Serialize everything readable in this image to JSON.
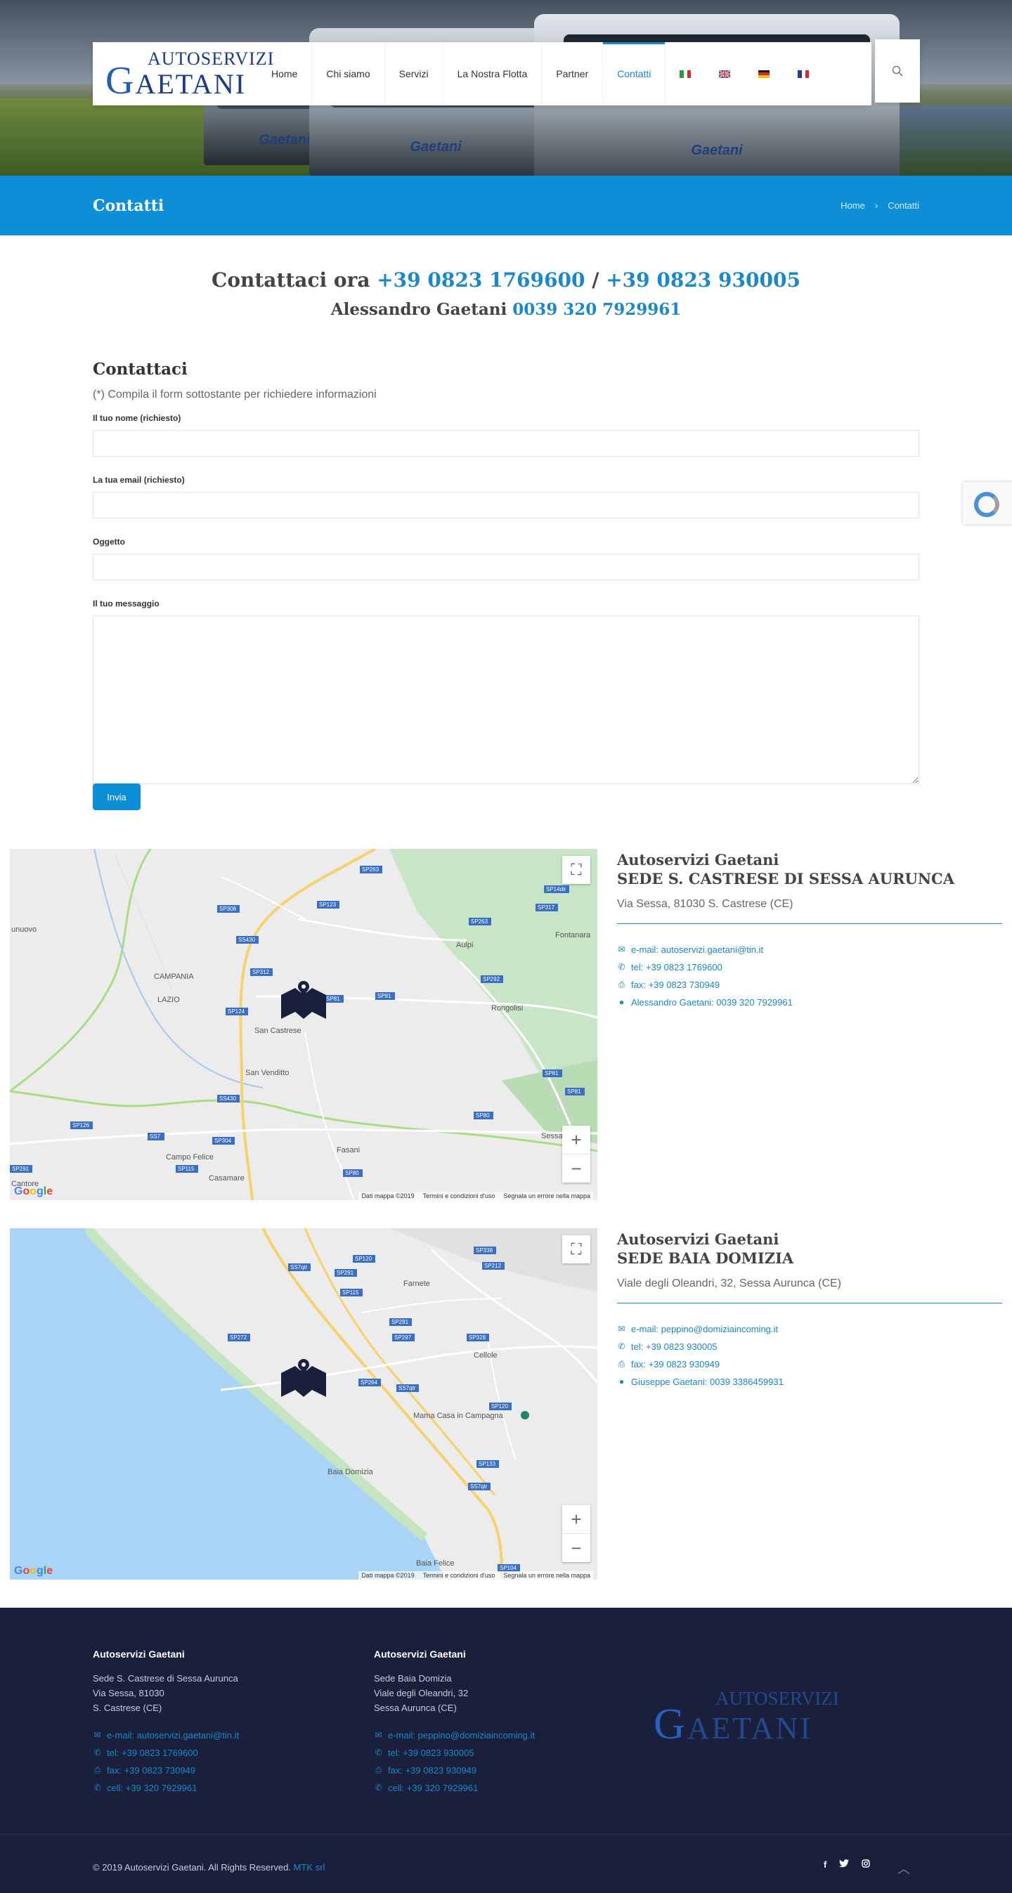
{
  "header": {
    "brand_top": "AUTOSERVIZI",
    "brand_initial": "G",
    "brand_rest": "AETANI",
    "nav": [
      {
        "label": "Home"
      },
      {
        "label": "Chi siamo"
      },
      {
        "label": "Servizi"
      },
      {
        "label": "La Nostra Flotta"
      },
      {
        "label": "Partner"
      },
      {
        "label": "Contatti",
        "active": true
      }
    ],
    "flags": [
      "flag-it-icon",
      "flag-gb-icon",
      "flag-de-icon",
      "flag-fr-icon"
    ],
    "hero_bus_logo": "Gaetani"
  },
  "titlebar": {
    "title": "Contatti",
    "breadcrumb": [
      "Home",
      "Contatti"
    ]
  },
  "cta": {
    "prefix": "Contattaci ora",
    "phone1": "+39 0823 1769600",
    "slash": "/",
    "phone2": "+39 0823 930005",
    "person": "Alessandro Gaetani",
    "person_phone": "0039 320 7929961"
  },
  "form": {
    "title": "Contattaci",
    "hint": "(*) Compila il form sottostante per richiedere informazioni",
    "name_label": "Il tuo nome (richiesto)",
    "email_label": "La tua email (richiesto)",
    "subject_label": "Oggetto",
    "message_label": "Il tuo messaggio",
    "submit": "Invia"
  },
  "maps": {
    "data_label": "Dati mappa ©2019",
    "terms_label": "Termini e condizioni d'uso",
    "report_label": "Segnala un errore nella mappa",
    "map1": {
      "places": [
        "unuovo",
        "Aulpi",
        "Fontanara",
        "CAMPANIA",
        "LAZIO",
        "San Castrese",
        "Rongolisi",
        "San Venditto",
        "Campo Felice",
        "Fasani",
        "Casamare",
        "Cantore",
        "Sessa"
      ],
      "roads": [
        "SP263",
        "SP308",
        "SP123",
        "SS430",
        "SP317",
        "SP263",
        "SP312",
        "SP292",
        "SP81",
        "SP124",
        "SP81",
        "SS430",
        "SP126",
        "SS7",
        "SP304",
        "SP115",
        "SP291",
        "SP80",
        "SP80",
        "SP81",
        "SP14dir"
      ]
    },
    "map2": {
      "places": [
        "Farnete",
        "Cellole",
        "Mama Casa in Campagna",
        "Baia Domizia",
        "Baia Felice"
      ],
      "roads": [
        "SS7qtr",
        "SP291",
        "SP120",
        "SP338",
        "SP212",
        "SP115",
        "SP272",
        "SP291",
        "SP297",
        "SP328",
        "SP264",
        "SS7qtr",
        "SP120",
        "SP133",
        "SS7qtr",
        "SP104"
      ]
    }
  },
  "offices": [
    {
      "company": "Autoservizi Gaetani",
      "site": "SEDE S. CASTRESE DI SESSA AURUNCA",
      "address": "Via Sessa, 81030 S. Castrese (CE)",
      "email": "e-mail: autoservizi.gaetani@tin.it",
      "tel": "tel: +39 0823 1769600",
      "fax": "fax: +39 0823 730949",
      "person": "Alessandro Gaetani: 0039 320 7929961"
    },
    {
      "company": "Autoservizi Gaetani",
      "site": "SEDE BAIA DOMIZIA",
      "address": "Viale degli Oleandri, 32, Sessa Aurunca (CE)",
      "email": "e-mail: peppino@domiziaincoming.it",
      "tel": "tel: +39 0823 930005",
      "fax": "fax: +39 0823 930949",
      "person": "Giuseppe Gaetani: 0039 3386459931"
    }
  ],
  "footer": {
    "col1": {
      "title": "Autoservizi Gaetani",
      "line1": "Sede S. Castrese di Sessa Aurunca",
      "line2": "Via Sessa, 81030",
      "line3": "S. Castrese (CE)",
      "email": "e-mail: autoservizi.gaetani@tin.it",
      "tel": "tel: +39 0823 1769600",
      "fax": "fax: +39 0823 730949",
      "cell": "cell: +39 320 7929961"
    },
    "col2": {
      "title": "Autoservizi Gaetani",
      "line1": "Sede Baia Domizia",
      "line2": "Viale degli Oleandri, 32",
      "line3": "Sessa Aurunca (CE)",
      "email": "e-mail: peppino@domiziaincoming.it",
      "tel": "tel: +39 0823 930005",
      "fax": "fax: +39 0823 930949",
      "cell": "cell: +39 320 7929961"
    },
    "logo_top": "AUTOSERVIZI",
    "logo_initial": "G",
    "logo_rest": "AETANI",
    "copyright": "© 2019 Autoservizi Gaetani. All Rights Reserved.",
    "credit": "MTK srl",
    "social": [
      "facebook-icon",
      "twitter-icon",
      "instagram-icon"
    ]
  },
  "colors": {
    "accent": "#0d8fd8",
    "footer_bg": "#1a1f3c",
    "brand": "#1a3a8a"
  }
}
